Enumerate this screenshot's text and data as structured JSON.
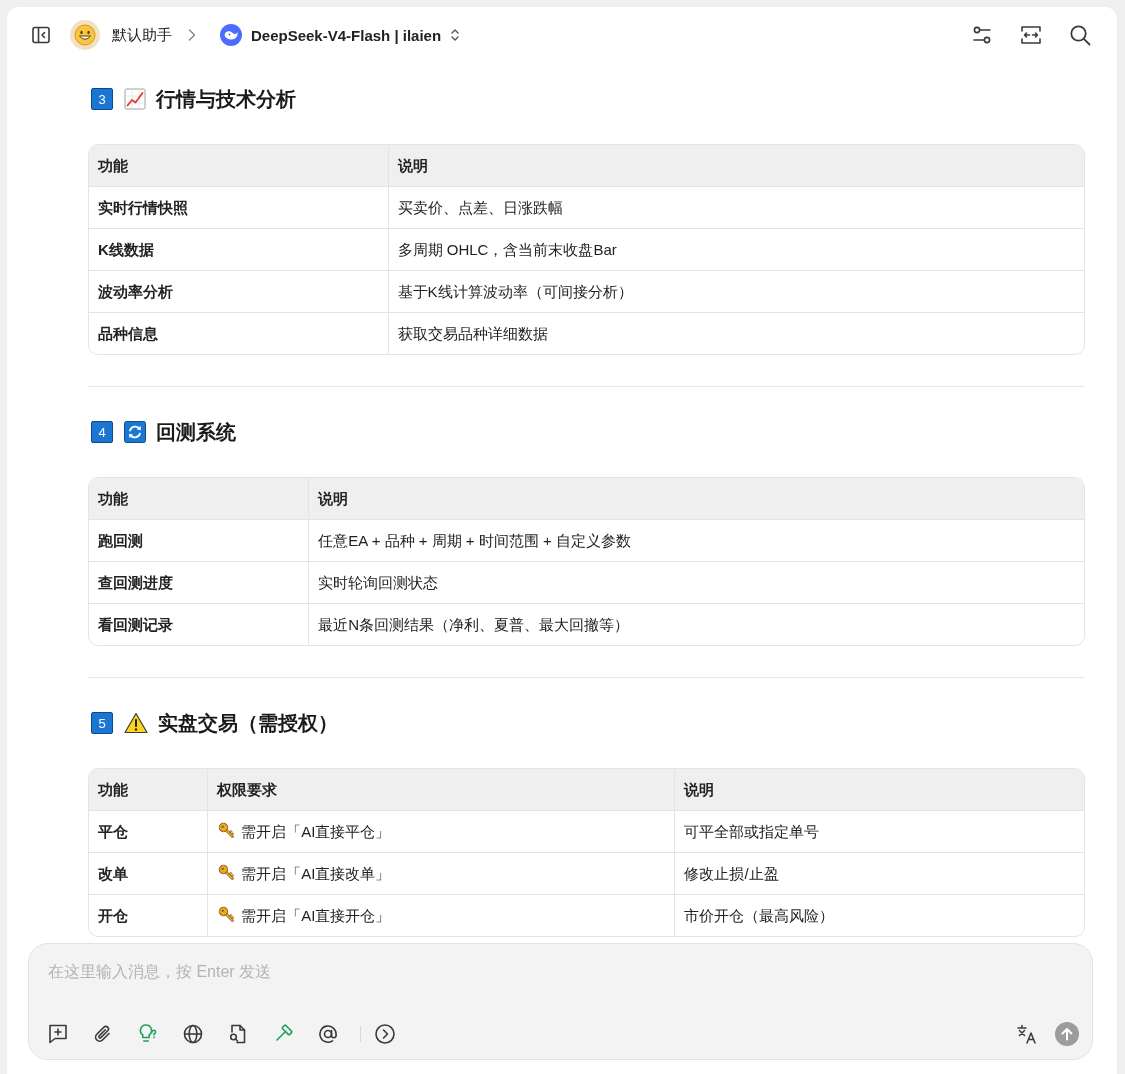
{
  "header": {
    "assistant": "默认助手",
    "model": "DeepSeek-V4-Flash | ilaien"
  },
  "sections": [
    {
      "number": "3",
      "kind": "analysis",
      "title": "行情与技术分析",
      "table": {
        "columns": [
          {
            "label": "功能",
            "kind": "feature"
          },
          {
            "label": "说明",
            "kind": "text"
          }
        ],
        "rows": [
          [
            "实时行情快照",
            "买卖价、点差、日涨跌幅"
          ],
          [
            "K线数据",
            "多周期 OHLC，含当前末收盘Bar"
          ],
          [
            "波动率分析",
            "基于K线计算波动率（可间接分析）"
          ],
          [
            "品种信息",
            "获取交易品种详细数据"
          ]
        ]
      }
    },
    {
      "number": "4",
      "kind": "backtest",
      "title": "回测系统",
      "table": {
        "columns": [
          {
            "label": "功能",
            "kind": "feature"
          },
          {
            "label": "说明",
            "kind": "text"
          }
        ],
        "rows": [
          [
            "跑回测",
            "任意EA + 品种 + 周期 + 时间范围 + 自定义参数"
          ],
          [
            "查回测进度",
            "实时轮询回测状态"
          ],
          [
            "看回测记录",
            "最近N条回测结果（净利、夏普、最大回撤等）"
          ]
        ]
      }
    },
    {
      "number": "5",
      "kind": "trading",
      "title": "实盘交易（需授权）",
      "table": {
        "columns": [
          {
            "label": "功能",
            "kind": "feature"
          },
          {
            "label": "权限要求",
            "kind": "permission"
          },
          {
            "label": "说明",
            "kind": "text"
          }
        ],
        "rows": [
          [
            "平仓",
            "需开启「AI直接平仓」",
            "可平全部或指定单号"
          ],
          [
            "改单",
            "需开启「AI直接改单」",
            "修改止损/止盈"
          ],
          [
            "开仓",
            "需开启「AI直接开仓」",
            "市价开仓（最高风险）"
          ]
        ]
      }
    }
  ],
  "composer": {
    "placeholder": "在这里输入消息，按 Enter 发送",
    "tools": [
      {
        "kind": "topic",
        "on": false
      },
      {
        "kind": "attach",
        "on": false
      },
      {
        "kind": "thinking",
        "on": true
      },
      {
        "kind": "web",
        "on": false
      },
      {
        "kind": "knowledge",
        "on": false
      },
      {
        "kind": "mcp",
        "on": true
      },
      {
        "kind": "mention",
        "on": false
      },
      {
        "kind": "more",
        "on": false
      }
    ],
    "send": {
      "disabled": true
    }
  }
}
